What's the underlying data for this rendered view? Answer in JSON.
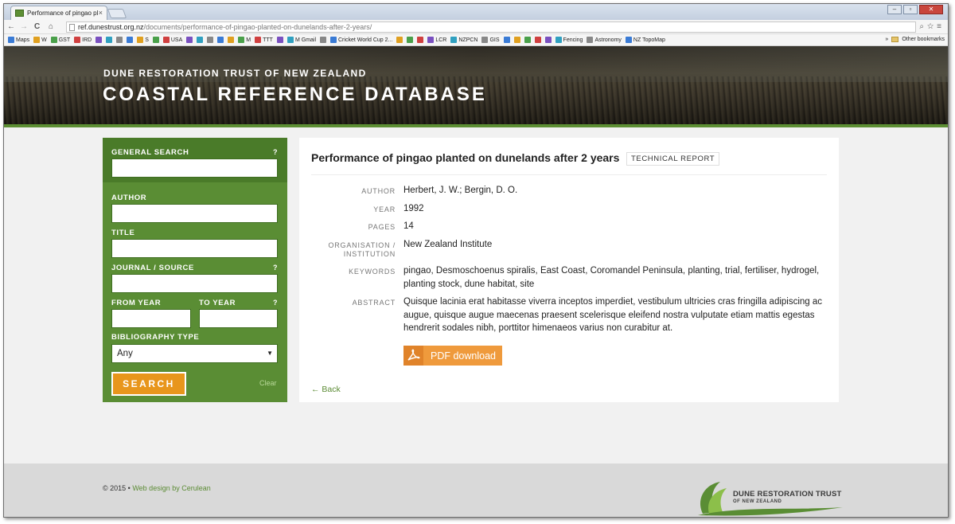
{
  "browser": {
    "tab_title": "Performance of pingao pl",
    "tab_close": "×",
    "url_domain": "ref.dunestrust.org.nz",
    "url_path": "/documents/performance-of-pingao-planted-on-dunelands-after-2-years/",
    "bookmarks": [
      "Maps",
      "W",
      "GST",
      "IRD",
      "",
      "",
      "",
      "",
      "S",
      "",
      "USA",
      "",
      "",
      "",
      "",
      "",
      "M",
      "TTT",
      "",
      "M Gmail",
      "",
      "Cricket World Cup 2...",
      "",
      "",
      "",
      "LCR",
      "NZPCN",
      "GIS",
      "",
      "",
      "",
      "",
      "",
      "Fencing",
      "Astronomy",
      "NZ TopoMap"
    ],
    "other_bookmarks": "Other bookmarks",
    "bookmarks_overflow": "»",
    "nav_back": "←",
    "nav_forward": "→",
    "nav_reload": "C",
    "nav_home": "⌂",
    "colors": {
      "chrome": "#d9e2ee",
      "accent_green": "#5a8d34",
      "orange": "#e8961c"
    }
  },
  "header": {
    "org": "DUNE RESTORATION TRUST OF NEW ZEALAND",
    "title": "COASTAL REFERENCE DATABASE"
  },
  "sidebar": {
    "general_search_label": "GENERAL SEARCH",
    "help": "?",
    "author_label": "AUTHOR",
    "title_label": "TITLE",
    "journal_label": "JOURNAL / SOURCE",
    "from_year_label": "FROM YEAR",
    "to_year_label": "TO YEAR",
    "bib_type_label": "BIBLIOGRAPHY TYPE",
    "bib_type_value": "Any",
    "bib_type_arrow": "▼",
    "search_button": "SEARCH",
    "clear": "Clear",
    "inputs": {
      "general": "",
      "author": "",
      "title": "",
      "journal": "",
      "from_year": "",
      "to_year": ""
    }
  },
  "document": {
    "title": "Performance of pingao planted on dunelands after 2 years",
    "type": "TECHNICAL REPORT",
    "author_label": "AUTHOR",
    "author": "Herbert, J. W.; Bergin, D. O.",
    "year_label": "YEAR",
    "year": "1992",
    "pages_label": "PAGES",
    "pages": "14",
    "org_label_1": "ORGANISATION /",
    "org_label_2": "INSTITUTION",
    "org": "New Zealand Institute",
    "keywords_label": "KEYWORDS",
    "keywords": "pingao, Desmoschoenus spiralis, East Coast, Coromandel Peninsula, planting, trial, fertiliser, hydrogel, planting stock, dune habitat, site",
    "abstract_label": "ABSTRACT",
    "abstract": "Quisque lacinia erat habitasse viverra inceptos imperdiet, vestibulum ultricies cras fringilla adipiscing ac augue, quisque augue maecenas praesent scelerisque eleifend nostra vulputate etiam mattis egestas hendrerit sodales nibh, porttitor himenaeos varius non curabitur at.",
    "pdf_button": "PDF download",
    "back": "← Back"
  },
  "footer": {
    "copyright": "© 2015",
    "sep": "•",
    "credit": "Web design by Cerulean",
    "logo_line1": "DUNE RESTORATION TRUST",
    "logo_line2": "OF NEW ZEALAND"
  }
}
